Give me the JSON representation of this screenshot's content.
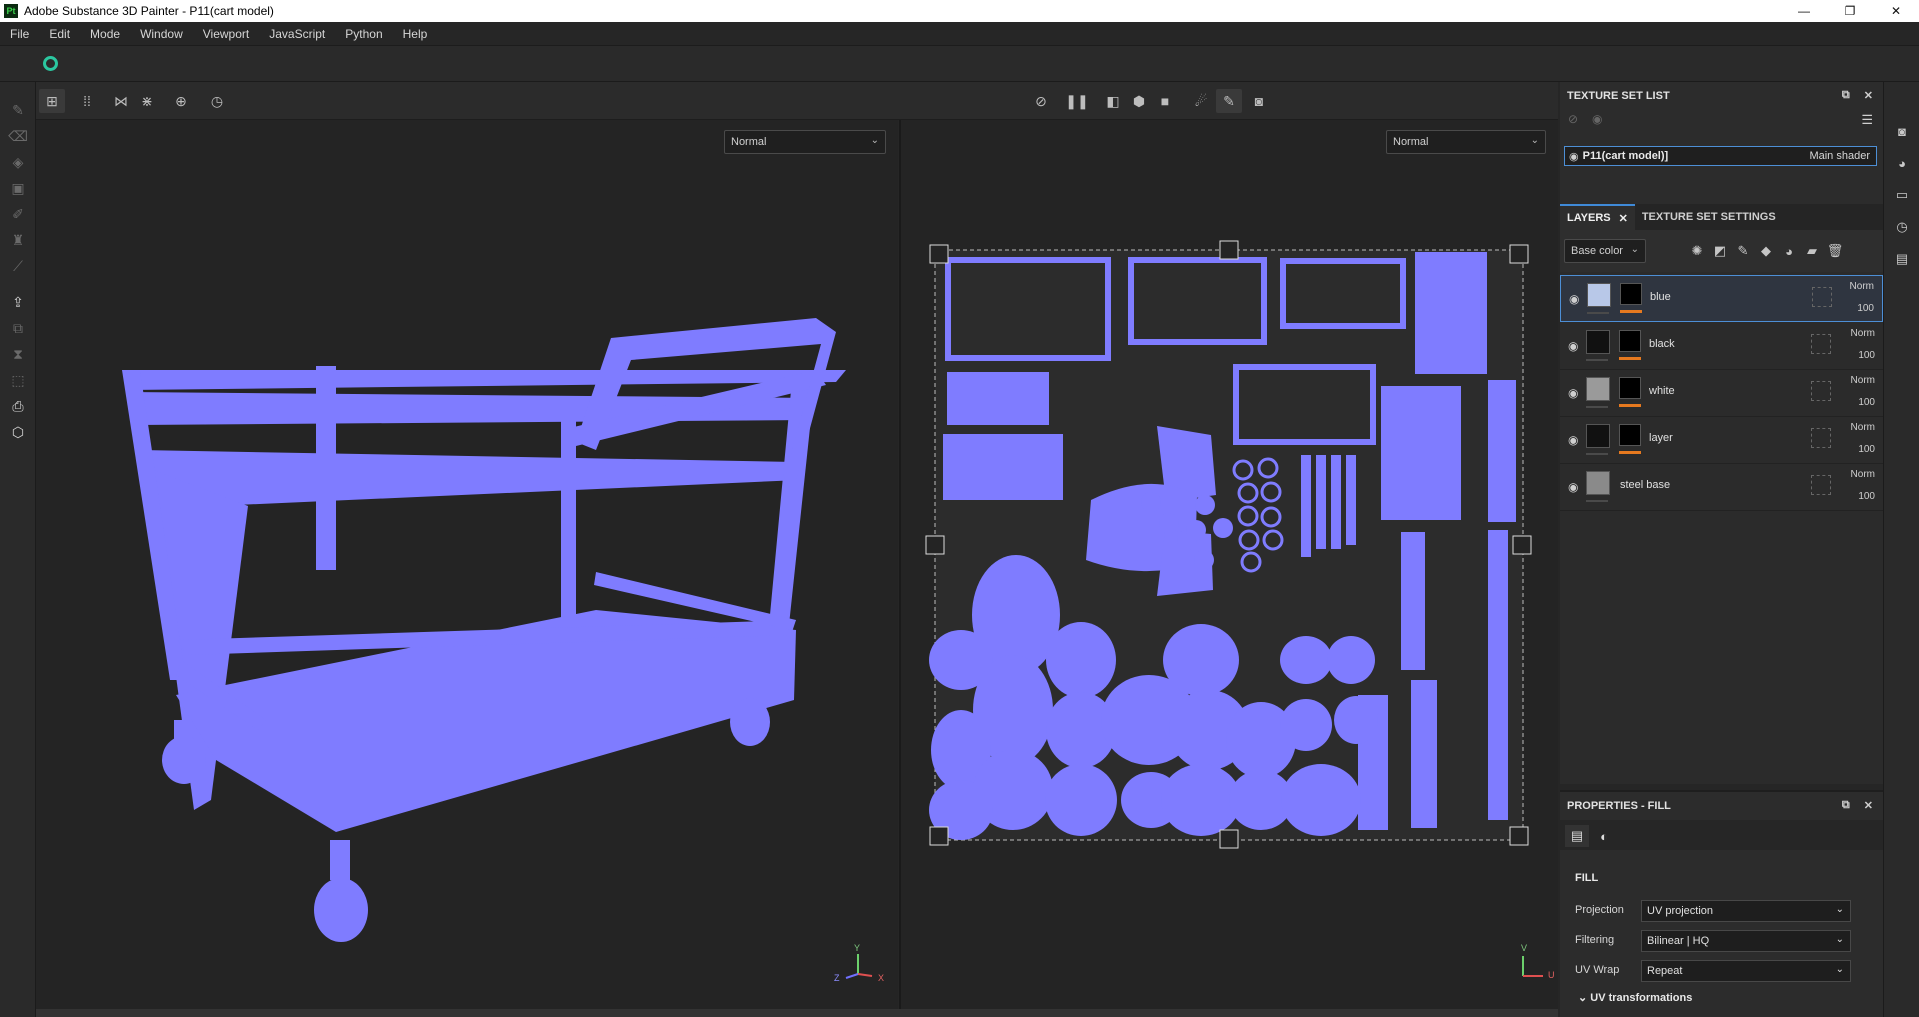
{
  "window": {
    "app_icon": "Pt",
    "title": "Adobe Substance 3D Painter - P11(cart model)",
    "minimize": "—",
    "maximize": "❐",
    "close": "✕"
  },
  "menu": [
    "File",
    "Edit",
    "Mode",
    "Window",
    "Viewport",
    "JavaScript",
    "Python",
    "Help"
  ],
  "viewport3d": {
    "mode_select": "Normal",
    "axis_y": "Y",
    "axis_z": "Z",
    "axis_x": "X"
  },
  "viewport2d": {
    "mode_select": "Normal",
    "axis_v": "V",
    "axis_u": "U"
  },
  "texture_set_list": {
    "title": "TEXTURE SET LIST",
    "set_name": "P11(cart model)]",
    "shader": "Main shader"
  },
  "tabs": {
    "layers": "LAYERS",
    "texture_set_settings": "TEXTURE SET SETTINGS",
    "close": "✕"
  },
  "channel_select": "Base color",
  "layers": [
    {
      "name": "blue",
      "blend": "Norm",
      "opacity": "100",
      "color": "#b8c8e8"
    },
    {
      "name": "black",
      "blend": "Norm",
      "opacity": "100",
      "color": "#111111"
    },
    {
      "name": "white",
      "blend": "Norm",
      "opacity": "100",
      "color": "#9a9a9a"
    },
    {
      "name": "layer",
      "blend": "Norm",
      "opacity": "100",
      "color": "#111111"
    },
    {
      "name": "steel base",
      "blend": "Norm",
      "opacity": "100",
      "color": "#8a8a8a"
    }
  ],
  "properties": {
    "title": "PROPERTIES - FILL",
    "fill_header": "FILL",
    "projection_label": "Projection",
    "projection_value": "UV projection",
    "filtering_label": "Filtering",
    "filtering_value": "Bilinear | HQ",
    "uvwrap_label": "UV Wrap",
    "uvwrap_value": "Repeat",
    "uv_transformations": "UV transformations"
  },
  "colors": {
    "mesh": "#7f7cff",
    "accent": "#3f8ad8",
    "orange": "#e6791f"
  }
}
